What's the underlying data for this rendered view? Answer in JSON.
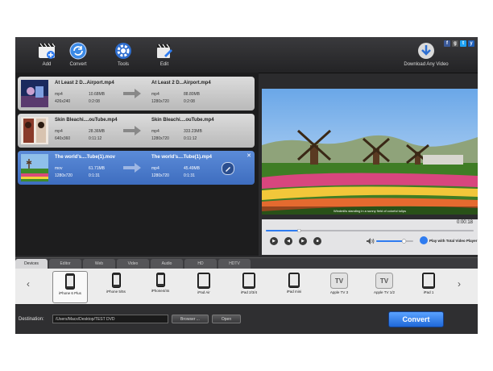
{
  "toolbar": {
    "add_label": "Add",
    "convert_label": "Convert",
    "tools_label": "Tools",
    "edit_label": "Edit",
    "download_label": "Download Any Video",
    "social": [
      "f",
      "g",
      "t",
      "y"
    ]
  },
  "files": [
    {
      "source_name": "At Least 2 D...Airport.mp4",
      "source_format": "mp4",
      "source_size": "10.68MB",
      "source_resolution": "426x240",
      "source_duration": "0:2:08",
      "output_name": "At Least 2 D...Airport.mp4",
      "output_format": "mp4",
      "output_size": "88.80MB",
      "output_resolution": "1280x720",
      "output_duration": "0:2:08"
    },
    {
      "source_name": "Skin Bleachi....ouTube.mp4",
      "source_format": "mp4",
      "source_size": "28.36MB",
      "source_resolution": "640x360",
      "source_duration": "0:11:12",
      "output_name": "Skin Bleachi....ouTube.mp4",
      "output_format": "mp4",
      "output_size": "333.23MB",
      "output_resolution": "1280x720",
      "output_duration": "0:11:12"
    },
    {
      "source_name": "The world's....Tube(1).mov",
      "source_format": "mov",
      "source_size": "61.71MB",
      "source_resolution": "1280x720",
      "source_duration": "0:1:31",
      "output_name": "The world's....Tube(1).mp4",
      "output_format": "mp4",
      "output_size": "45.49MB",
      "output_resolution": "1280x720",
      "output_duration": "0:1:31",
      "close": "✕"
    }
  ],
  "player": {
    "time": "0:00:18",
    "progress": 0.16,
    "volume": 0.75,
    "airplay_label": "Play with Total Video Player",
    "subtitle_text": "Windmills standing in a sunny field of colorful tulips"
  },
  "tabs": [
    {
      "label": "Devices",
      "active": true
    },
    {
      "label": "Editor",
      "active": false
    },
    {
      "label": "Web",
      "active": false
    },
    {
      "label": "Video",
      "active": false
    },
    {
      "label": "Audio",
      "active": false
    },
    {
      "label": "HD",
      "active": false
    },
    {
      "label": "HDTV",
      "active": false
    }
  ],
  "devices": {
    "prev_arrow": "‹",
    "next_arrow": "›",
    "items": [
      {
        "label": "iPhone 6 Plus",
        "icon": "iphone-icon",
        "selected": true
      },
      {
        "label": "iPhone 5/5s",
        "icon": "iphone-icon",
        "selected": false
      },
      {
        "label": "iPhone4/4s",
        "icon": "iphone-icon",
        "selected": false
      },
      {
        "label": "iPad Air",
        "icon": "ipad-icon",
        "selected": false
      },
      {
        "label": "iPad 2/3/4",
        "icon": "ipad-icon",
        "selected": false
      },
      {
        "label": "iPad mini",
        "icon": "ipad-icon",
        "selected": false
      },
      {
        "label": "Apple TV 3",
        "icon": "appletv-icon",
        "tv_text": "TV",
        "selected": false
      },
      {
        "label": "Apple TV 1/2",
        "icon": "appletv-icon",
        "tv_text": "TV",
        "selected": false
      },
      {
        "label": "iPad 1",
        "icon": "ipad-icon",
        "selected": false
      }
    ]
  },
  "bottom": {
    "destination_label": "Destination:",
    "destination_path": "/Users/Macx/Desktop/TEST DVD",
    "browse_label": "Browser ...",
    "open_label": "Open",
    "convert_label": "Convert"
  },
  "colors": {
    "accent": "#2f7cf0",
    "selected_row": "#4a78c8",
    "background": "#2b2b2d"
  }
}
